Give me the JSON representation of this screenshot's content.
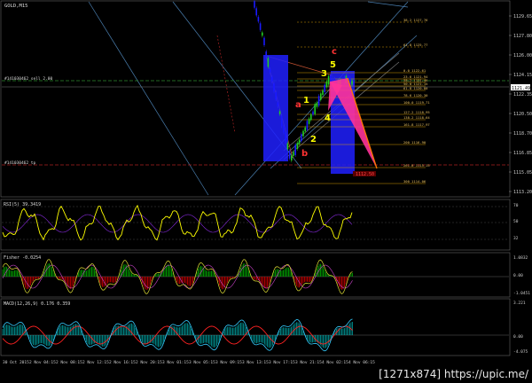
{
  "symbol_title": "GOLD,M15",
  "main_pane": {
    "line_top_label": "#141030462 sell 2.00",
    "line_bottom_label": "#141030462 tp",
    "price_ticks": [
      "1129.65",
      "1127.80",
      "1126.00",
      "1124.15",
      "1122.35",
      "1120.50",
      "1118.70",
      "1116.85",
      "1115.05",
      "1113.20"
    ],
    "current_price": "1121.49",
    "fib_labels": [
      "38.2 1127.76",
      "61.8 1125.77",
      "0.0 1122.61",
      "23.6 1121.94",
      "38.2 1121.46",
      "50.0 1121.15",
      "61.8 1120.80",
      "78.6 1120.30",
      "100.0 1119.71",
      "127.2 1118.95",
      "138.2 1118.64",
      "161.8 1117.97",
      "200 1116.90",
      "261.8 1115.15",
      "300 1114.06"
    ],
    "target_label": "1112.50",
    "wave_labels": {
      "a": "a",
      "b": "b",
      "c": "c",
      "w1": "1",
      "w2": "2",
      "w3": "3",
      "w4": "4",
      "w5": "5"
    }
  },
  "rsi_pane": {
    "title": "RSI(5) 39.3419",
    "ticks": [
      "70",
      "50",
      "32"
    ]
  },
  "fisher_pane": {
    "title": "Fisher -0.0254",
    "ticks": [
      "1.0832",
      "0.00",
      "-1.0451"
    ]
  },
  "macd_pane": {
    "title": "MACD(12,26,9) 0.176 0.359",
    "ticks": [
      "3.221",
      "0.00",
      "-4.075"
    ]
  },
  "time_axis": [
    "30 Oct 2015",
    "2 Nov 04:15",
    "2 Nov 08:15",
    "2 Nov 12:15",
    "2 Nov 16:15",
    "2 Nov 20:15",
    "3 Nov 01:15",
    "3 Nov 05:15",
    "3 Nov 09:15",
    "3 Nov 13:15",
    "3 Nov 17:15",
    "3 Nov 21:15",
    "4 Nov 02:15",
    "4 Nov 06:15"
  ],
  "watermark": "[1271x874] https://upic.me/",
  "colors": {
    "bull": "#22cc22",
    "bear": "#2b2bff",
    "rsi": "#ffff00",
    "fisher_pos": "#00aa00",
    "fisher_neg": "#cc0000",
    "macd_hist": "#00cccc",
    "macd_sig": "#ff2222",
    "fib": "#e6a800"
  }
}
